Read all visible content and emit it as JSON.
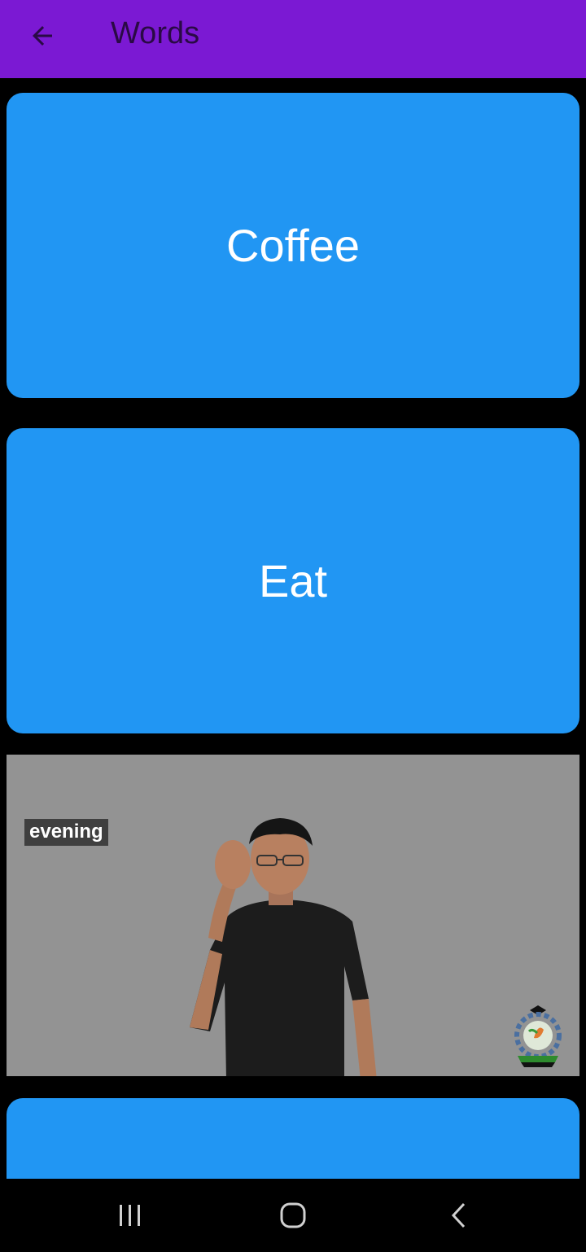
{
  "appbar": {
    "title": "Words",
    "back_icon": "arrow-left-icon"
  },
  "words": [
    {
      "label": "Coffee"
    },
    {
      "label": "Eat"
    }
  ],
  "video": {
    "caption": "evening"
  },
  "colors": {
    "appbar": "#7b19d3",
    "card": "#2196f3",
    "background": "#000000"
  },
  "navbar": {
    "icons": [
      "recent-apps-icon",
      "home-icon",
      "back-icon"
    ]
  }
}
